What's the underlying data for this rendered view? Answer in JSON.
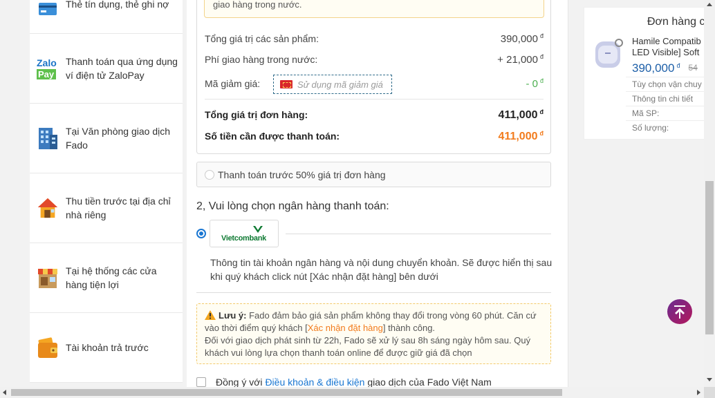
{
  "payment_methods": [
    {
      "label": "Thẻ tín dụng, thẻ ghi nợ",
      "icon": "credit-card-icon"
    },
    {
      "label": "Thanh toán qua ứng dụng ví điện tử ZaloPay",
      "icon": "zalopay-icon",
      "icon_text_top": "Zalo",
      "icon_text_bottom": "Pay"
    },
    {
      "label": "Tại Văn phòng giao dịch Fado",
      "icon": "office-building-icon"
    },
    {
      "label": "Thu tiền trước tại địa chỉ nhà riêng",
      "icon": "house-icon"
    },
    {
      "label": "Tại hệ thống các cửa hàng tiện lợi",
      "icon": "store-icon"
    },
    {
      "label": "Tài khoản trả trước",
      "icon": "wallet-icon"
    }
  ],
  "summary": {
    "notice_text": "giao hàng trong nước.",
    "products_label": "Tổng giá trị các sản phẩm:",
    "products_value": "390,000",
    "shipping_label": "Phí giao hàng trong nước:",
    "shipping_value": "+ 21,000",
    "discount_label": "Mã giảm giá:",
    "discount_placeholder": "Sử dụng mã giảm giá",
    "discount_value": "- 0",
    "total_label": "Tổng giá trị đơn hàng:",
    "total_value": "411,000",
    "pay_label": "Số tiền cần được thanh toán:",
    "pay_value": "411,000",
    "currency_symbol": "đ"
  },
  "half_payment_option": "Thanh toán trước 50% giá trị đơn hàng",
  "bank_step": {
    "title": "2, Vui lòng chọn ngân hàng thanh toán:",
    "bank_name": "Vietcombank",
    "info": "Thông tin tài khoản ngân hàng và nội dung chuyển khoản. Sẽ được hiển thị sau khi quý khách click nút [Xác nhận đặt hàng] bên dưới"
  },
  "warning": {
    "title": "Lưu ý:",
    "text1": " Fado đảm bảo giá sản phẩm không thay đổi trong vòng 60 phút. Căn cứ vào thời điểm quý khách [",
    "link": "Xác nhận đặt hàng",
    "text2": "] thành công.",
    "text3": "Đối với giao dịch phát sinh từ 22h, Fado sẽ xử lý sau 8h sáng ngày hôm sau. Quý khách vui lòng lựa chọn thanh toán online để được giữ giá đã chọn"
  },
  "agree": {
    "prefix": "Đồng ý với ",
    "link": "Điều khoản & điều kiện",
    "suffix": " giao dịch của Fado Việt Nam"
  },
  "order_panel": {
    "title": "Đơn hàng c",
    "product_name_line1": "Hamile Compatib",
    "product_name_line2": "LED Visible] Soft",
    "price": "390,000",
    "currency_symbol": "đ",
    "old_price": "54",
    "row1": "Tùy chọn vận chuy",
    "row2": "Thông tin chi tiết",
    "row3": "Mã SP:",
    "row4": "Số lượng:"
  },
  "colors": {
    "accent_orange": "#f27b1c",
    "link_blue": "#1976d2",
    "price_blue": "#1d5fa8",
    "discount_green": "#4caf50",
    "vietcombank_green": "#0f7a33"
  }
}
